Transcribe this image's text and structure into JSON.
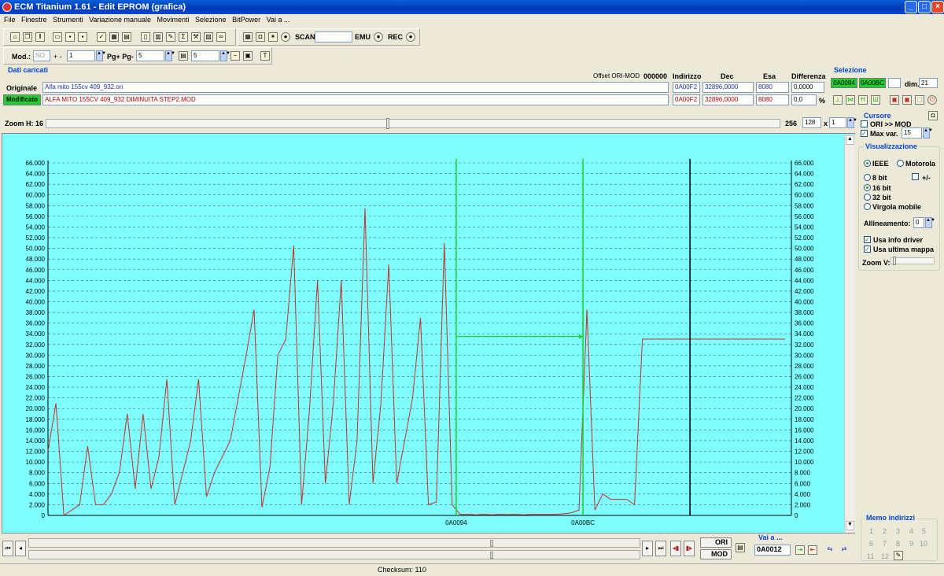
{
  "window": {
    "title": "ECM Titanium 1.61 - Edit EPROM (grafica)"
  },
  "menu": [
    "File",
    "Finestre",
    "Strumenti",
    "Variazione manuale",
    "Movimenti",
    "Selezione",
    "BitPower",
    "Vai a ..."
  ],
  "toolbar": {
    "scan_label": "SCAN",
    "emu_label": "EMU",
    "rec_label": "REC",
    "mod_label": "Mod.:",
    "mod_value": "NO",
    "plusminus_label": "+ -",
    "step_value": "1",
    "pg_label": "Pg+ Pg-",
    "pg_value": "5",
    "t_value": "5"
  },
  "dati": {
    "title": "Dati caricati",
    "offset_label": "Offset ORI-MOD",
    "offset_value": "000000",
    "col_indirizzo": "Indirizzo",
    "col_dec": "Dec",
    "col_esa": "Esa",
    "col_diff": "Differenza",
    "originale_label": "Originale",
    "originale_file": "Alfa mito 155cv 409_932.ori",
    "originale_addr": "0A00F2",
    "originale_dec": "32896,0000",
    "originale_esa": "8080",
    "originale_diff": "0,0000",
    "modificato_label": "Modificato",
    "modificato_file": "ALFA MITO 155CV 409_932 DIMINUITA STEP2.MOD",
    "modificato_addr": "0A00F2",
    "modificato_dec": "32896,0000",
    "modificato_esa": "8080",
    "modificato_diff": "0,0",
    "pct": "%"
  },
  "selezione": {
    "title": "Selezione",
    "start": "0A0094",
    "end": "0A00BC",
    "dim_label": "dim.",
    "dim_value": "21"
  },
  "zoom": {
    "label": "Zoom H: 16",
    "max": "256",
    "value": "128",
    "x_label": "x",
    "mult": "1"
  },
  "cursore": {
    "title": "Cursore",
    "ori_mod": "ORI >> MOD",
    "maxvar_label": "Max var.",
    "maxvar_value": "15"
  },
  "visualizzazione": {
    "title": "Visualizzazione",
    "ieee": "IEEE",
    "motorola": "Motorola",
    "bit8": "8 bit",
    "plusminus": "+/-",
    "bit16": "16 bit",
    "bit32": "32 bit",
    "virgola": "Virgola mobile",
    "allineamento_label": "Allineamento:",
    "allineamento_value": "0",
    "usa_info": "Usa info driver",
    "usa_ultima": "Usa ultima mappa",
    "zoomv_label": "Zoom V:"
  },
  "memo": {
    "title": "Memo indirizzi",
    "numbers": [
      "1",
      "2",
      "3",
      "4",
      "5",
      "6",
      "7",
      "8",
      "9",
      "10",
      "11",
      "12"
    ]
  },
  "bottom": {
    "ori_label": "ORI",
    "mod_label": "MOD",
    "vai_title": "Vai a ...",
    "vai_value": "0A0012",
    "checksum": "Checksum: 110"
  },
  "chart_data": {
    "type": "line",
    "y_ticks": [
      "0",
      "2.000",
      "4.000",
      "6.000",
      "8.000",
      "10.000",
      "12.000",
      "14.000",
      "16.000",
      "18.000",
      "20.000",
      "22.000",
      "24.000",
      "26.000",
      "28.000",
      "30.000",
      "32.000",
      "34.000",
      "36.000",
      "38.000",
      "40.000",
      "42.000",
      "44.000",
      "46.000",
      "48.000",
      "50.000",
      "52.000",
      "54.000",
      "56.000",
      "58.000",
      "60.000",
      "62.000",
      "64.000",
      "66.000"
    ],
    "ylim": [
      0,
      66000
    ],
    "x_markers": [
      "0A0094",
      "0A00BC"
    ],
    "grid": true,
    "series": [
      {
        "color": "#c0302b",
        "values": [
          12000,
          21000,
          0,
          1000,
          2000,
          13000,
          2000,
          2000,
          4000,
          8000,
          19000,
          5000,
          19000,
          5000,
          11000,
          25500,
          2000,
          8000,
          14000,
          25500,
          3500,
          8000,
          11000,
          14000,
          22000,
          30000,
          38500,
          1500,
          9000,
          30000,
          33000,
          50500,
          2000,
          20000,
          44000,
          6000,
          21000,
          44000,
          2000,
          14000,
          57500,
          6000,
          21000,
          47000,
          6000,
          14000,
          22000,
          37000,
          2000,
          2500,
          51000,
          2000,
          200,
          200,
          100,
          200,
          100,
          200,
          150,
          200,
          100,
          200,
          200,
          200,
          200,
          300,
          500,
          1000,
          38500,
          1000,
          4000,
          3000,
          3000,
          3000,
          2000,
          33000,
          33000,
          33000,
          33000,
          33000,
          33000,
          33000,
          33000,
          33000,
          33000,
          33000,
          33000,
          33000,
          33000,
          33000,
          33000,
          33000,
          33000,
          33000
        ]
      }
    ],
    "cursor_value": 33500
  }
}
